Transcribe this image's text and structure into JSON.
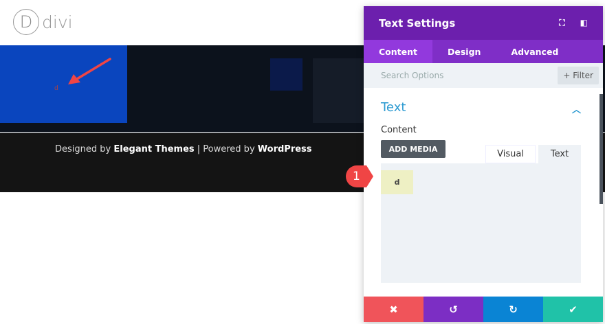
{
  "site": {
    "logo_letter": "D",
    "logo_text": "divi",
    "module_text": "d",
    "footer": {
      "prefix": "Designed by ",
      "brand1": "Elegant Themes",
      "sep": " | Powered by ",
      "brand2": "WordPress"
    }
  },
  "panel": {
    "title": "Text Settings",
    "tabs": [
      "Content",
      "Design",
      "Advanced"
    ],
    "search_placeholder": "Search Options",
    "filter_label": "+ Filter",
    "section_title": "Text",
    "content_label": "Content",
    "add_media": "ADD MEDIA",
    "editor_tabs": [
      "Visual",
      "Text"
    ],
    "editor_value": "d",
    "badge": "1",
    "actions": {
      "cancel": "✖",
      "undo": "↺",
      "redo": "↻",
      "save": "✔"
    }
  },
  "colors": {
    "header": "#6c1fad",
    "tabs": "#7f2ec7",
    "cancel": "#f0545a",
    "undo": "#7c2ec4",
    "redo": "#0a84d4",
    "save": "#20c2a8"
  }
}
